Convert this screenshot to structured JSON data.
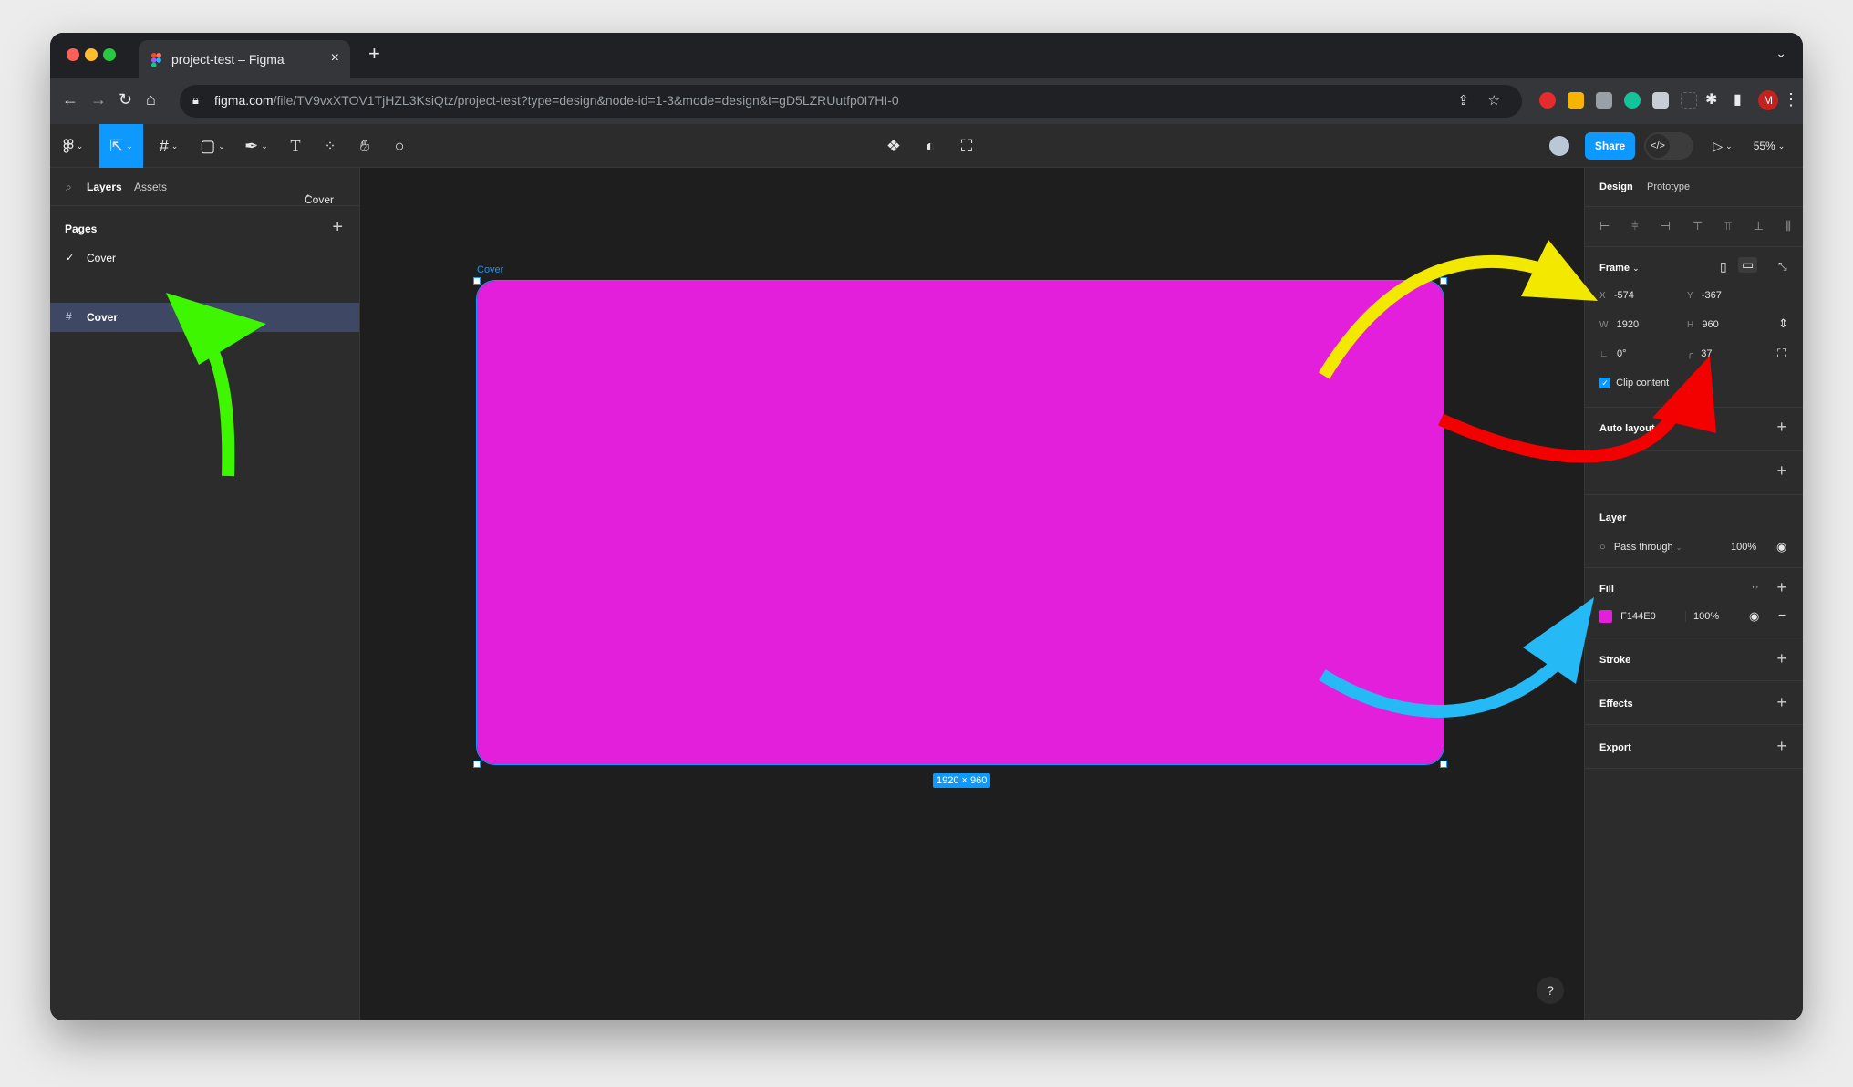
{
  "browser": {
    "tab_title": "project-test – Figma",
    "new_tab": "+",
    "close_tab": "×",
    "url_host": "figma.com",
    "url_path": "/file/TV9vxXTOV1TjHZL3KsiQtz/project-test?type=design&node-id=1-3&mode=design&t=gD5LZRUutfp0I7HI-0",
    "profile_initial": "M"
  },
  "toolbar": {
    "share_label": "Share",
    "zoom": "55%"
  },
  "left_panel": {
    "tabs": [
      "Layers",
      "Assets"
    ],
    "page_selector": "Cover",
    "pages_heading": "Pages",
    "pages": [
      {
        "name": "Cover",
        "checked": true
      }
    ],
    "layers": [
      {
        "name": "Cover",
        "selected": true
      }
    ]
  },
  "canvas": {
    "frame_name": "Cover",
    "frame_color": "#E41FDC",
    "dimension_label": "1920 × 960",
    "help": "?"
  },
  "right_panel": {
    "tabs": [
      "Design",
      "Prototype"
    ],
    "frame": {
      "title": "Frame",
      "x_label": "X",
      "x": "-574",
      "y_label": "Y",
      "y": "-367",
      "w_label": "W",
      "w": "1920",
      "h_label": "H",
      "h": "960",
      "rotation": "0°",
      "radius": "37",
      "clip_content": "Clip content"
    },
    "auto_layout": "Auto layout",
    "layer": {
      "title": "Layer",
      "blend": "Pass through",
      "opacity": "100%"
    },
    "fill": {
      "title": "Fill",
      "hex": "F144E0",
      "opacity": "100%",
      "swatch": "#E41FDC"
    },
    "stroke": "Stroke",
    "effects": "Effects",
    "export": "Export"
  },
  "annotations": {
    "arrow_colors": [
      "#3df600",
      "#f3e900",
      "#f30000",
      "#25b9f5"
    ]
  }
}
